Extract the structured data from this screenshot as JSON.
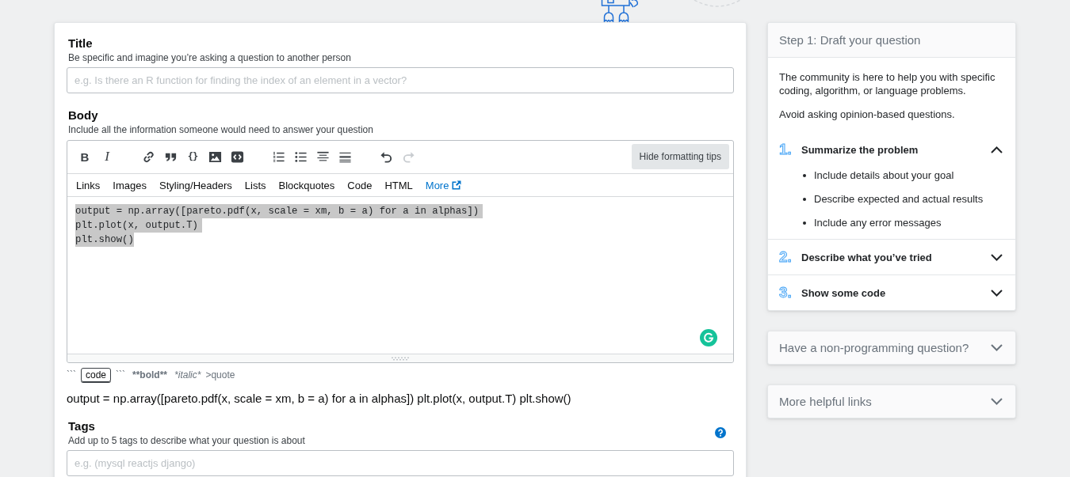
{
  "title_field": {
    "label": "Title",
    "description": "Be specific and imagine you’re asking a question to another person",
    "placeholder": "e.g. Is there an R function for finding the index of an element in a vector?"
  },
  "body_field": {
    "label": "Body",
    "description": "Include all the information someone would need to answer your question",
    "toolbar": {
      "groups": [
        {
          "buttons": [
            {
              "kind": "bold",
              "label": "B",
              "disabled": false
            },
            {
              "kind": "italic",
              "label": "I",
              "disabled": false
            }
          ]
        },
        {
          "buttons": [
            {
              "kind": "link",
              "disabled": false
            },
            {
              "kind": "quote",
              "disabled": false
            },
            {
              "kind": "code",
              "label": "{}",
              "disabled": false
            },
            {
              "kind": "image",
              "disabled": false
            },
            {
              "kind": "snippet",
              "disabled": false
            }
          ]
        },
        {
          "buttons": [
            {
              "kind": "olist",
              "disabled": false
            },
            {
              "kind": "ulist",
              "disabled": false
            },
            {
              "kind": "heading",
              "disabled": false
            },
            {
              "kind": "rule",
              "disabled": false
            }
          ]
        },
        {
          "buttons": [
            {
              "kind": "undo",
              "disabled": false
            },
            {
              "kind": "redo",
              "disabled": true
            }
          ]
        }
      ],
      "tips_button": "Hide formatting tips"
    },
    "help_links": [
      {
        "label": "Links",
        "external": false
      },
      {
        "label": "Images",
        "external": false
      },
      {
        "label": "Styling/Headers",
        "external": false
      },
      {
        "label": "Lists",
        "external": false
      },
      {
        "label": "Blockquotes",
        "external": false
      },
      {
        "label": "Code",
        "external": false
      },
      {
        "label": "HTML",
        "external": false
      },
      {
        "label": "More",
        "external": true
      }
    ],
    "editor": {
      "value": "output = np.array([pareto.pdf(x, scale = xm, b = a) for a in alphas])\nplt.plot(x, output.T)\nplt.show()",
      "highlighted": true
    },
    "format_tips": [
      {
        "kind": "plain",
        "text": "```"
      },
      {
        "kind": "kbd",
        "text": "code"
      },
      {
        "kind": "plain",
        "text": "```"
      },
      {
        "kind": "bold",
        "text": "**bold**"
      },
      {
        "kind": "italic",
        "text": "*italic*"
      },
      {
        "kind": "plain",
        "text": ">quote"
      }
    ],
    "preview": "output = np.array([pareto.pdf(x, scale = xm, b = a) for a in alphas]) plt.plot(x, output.T) plt.show()"
  },
  "tags_field": {
    "label": "Tags",
    "description": "Add up to 5 tags to describe what your question is about",
    "placeholder": "e.g. (mysql reactjs django)"
  },
  "sidebar": {
    "draft_card": {
      "title": "Step 1: Draft your question",
      "intro": [
        "The community is here to help you with specific coding, algorithm, or language problems.",
        "Avoid asking opinion-based questions."
      ],
      "steps": [
        {
          "number": "1.",
          "title": "Summarize the problem",
          "expanded": true,
          "bullets": [
            "Include details about your goal",
            "Describe expected and actual results",
            "Include any error messages"
          ]
        },
        {
          "number": "2.",
          "title": "Describe what you’ve tried",
          "expanded": false
        },
        {
          "number": "3.",
          "title": "Show some code",
          "expanded": false
        }
      ]
    },
    "cards": [
      {
        "title": "Have a non-programming question?",
        "expanded": false
      },
      {
        "title": "More helpful links",
        "expanded": false
      }
    ]
  }
}
